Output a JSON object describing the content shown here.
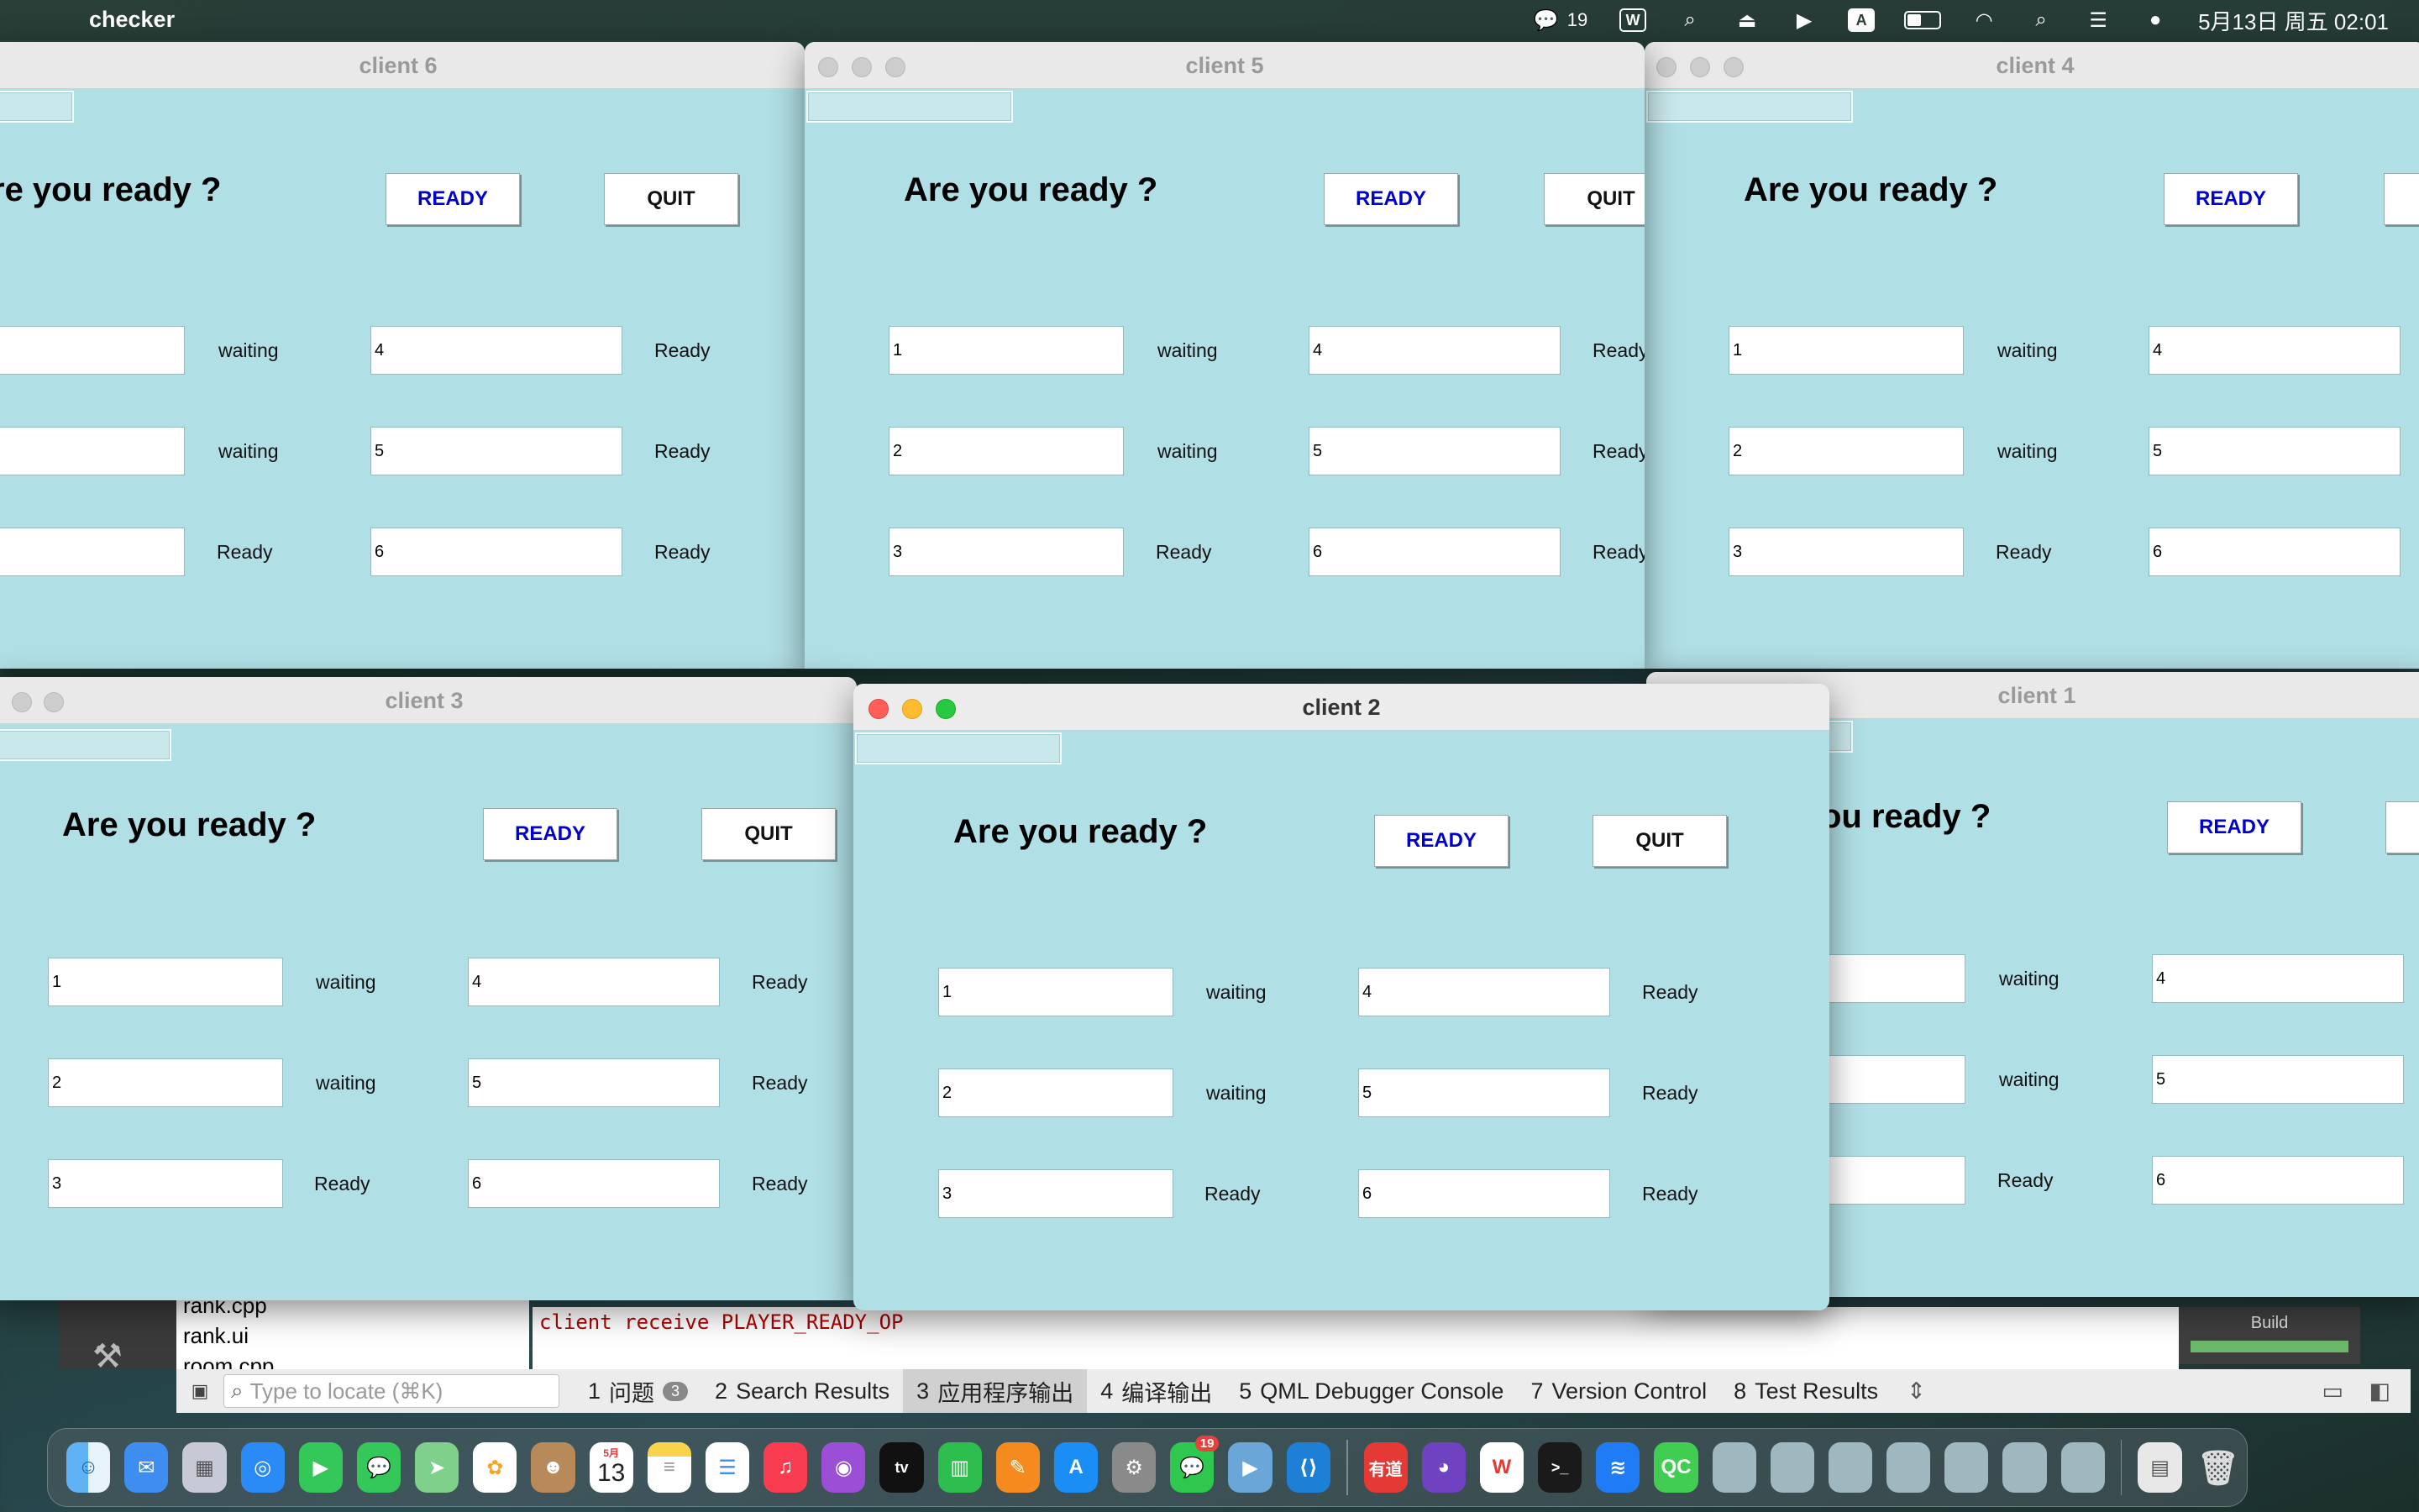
{
  "menubar": {
    "apple_icon": "apple-icon",
    "app_name": "checker",
    "wechat_count": "19",
    "datetime": "5月13日 周五 02:01",
    "input_method": "A",
    "wps_letter": "W"
  },
  "windows": {
    "client6": {
      "title": "client 6",
      "question": "re you ready ?",
      "ready_label": "READY",
      "quit_label": "QUIT",
      "slots": [
        {
          "name": "",
          "status": "waiting"
        },
        {
          "name": "",
          "status": "waiting"
        },
        {
          "name": "",
          "status": "Ready"
        },
        {
          "name": "4",
          "status": "Ready"
        },
        {
          "name": "5",
          "status": "Ready"
        },
        {
          "name": "6",
          "status": "Ready"
        }
      ]
    },
    "client5": {
      "title": "client 5",
      "question": "Are you ready ?",
      "ready_label": "READY",
      "quit_label": "QUIT",
      "slots": [
        {
          "name": "1",
          "status": "waiting"
        },
        {
          "name": "2",
          "status": "waiting"
        },
        {
          "name": "3",
          "status": "Ready"
        },
        {
          "name": "4",
          "status": "Ready"
        },
        {
          "name": "5",
          "status": "Ready"
        },
        {
          "name": "6",
          "status": "Ready"
        }
      ]
    },
    "client4": {
      "title": "client 4",
      "question": "Are you ready ?",
      "ready_label": "READY",
      "slots": [
        {
          "name": "1",
          "status": "waiting"
        },
        {
          "name": "2",
          "status": "waiting"
        },
        {
          "name": "3",
          "status": "Ready"
        },
        {
          "name": "4",
          "status": ""
        },
        {
          "name": "5",
          "status": ""
        },
        {
          "name": "6",
          "status": ""
        }
      ]
    },
    "client3": {
      "title": "client 3",
      "question": "Are you ready ?",
      "ready_label": "READY",
      "quit_label": "QUIT",
      "slots": [
        {
          "name": "1",
          "status": "waiting"
        },
        {
          "name": "2",
          "status": "waiting"
        },
        {
          "name": "3",
          "status": "Ready"
        },
        {
          "name": "4",
          "status": "Ready"
        },
        {
          "name": "5",
          "status": "Ready"
        },
        {
          "name": "6",
          "status": "Ready"
        }
      ]
    },
    "client2": {
      "title": "client 2",
      "question": "Are you ready ?",
      "ready_label": "READY",
      "quit_label": "QUIT",
      "slots": [
        {
          "name": "1",
          "status": "waiting"
        },
        {
          "name": "2",
          "status": "waiting"
        },
        {
          "name": "3",
          "status": "Ready"
        },
        {
          "name": "4",
          "status": "Ready"
        },
        {
          "name": "5",
          "status": "Ready"
        },
        {
          "name": "6",
          "status": "Ready"
        }
      ]
    },
    "client1": {
      "title": "client 1",
      "question": "ou ready ?",
      "ready_label": "READY",
      "slots": [
        {
          "name": "",
          "status": "waiting"
        },
        {
          "name": "",
          "status": "waiting"
        },
        {
          "name": "",
          "status": "Ready"
        },
        {
          "name": "4",
          "status": ""
        },
        {
          "name": "5",
          "status": ""
        },
        {
          "name": "6",
          "status": ""
        }
      ]
    }
  },
  "qt": {
    "files": [
      "rank.cpp",
      "rank.ui",
      "room.cpp"
    ],
    "output_line": "client receive PLAYER_READY_OP",
    "build_label": "Build",
    "locate_placeholder": "Type to locate (⌘K)",
    "tabs": [
      {
        "num": "1",
        "label": "问题",
        "badge": "3"
      },
      {
        "num": "2",
        "label": "Search Results"
      },
      {
        "num": "3",
        "label": "应用程序输出"
      },
      {
        "num": "4",
        "label": "编译输出"
      },
      {
        "num": "5",
        "label": "QML Debugger Console"
      },
      {
        "num": "7",
        "label": "Version Control"
      },
      {
        "num": "8",
        "label": "Test Results"
      }
    ]
  },
  "dock": {
    "calendar_month": "5月",
    "calendar_day": "13",
    "wechat_badge": "19",
    "youdao_label": "有道",
    "qc_label": "QC",
    "tv_label": "tv"
  }
}
